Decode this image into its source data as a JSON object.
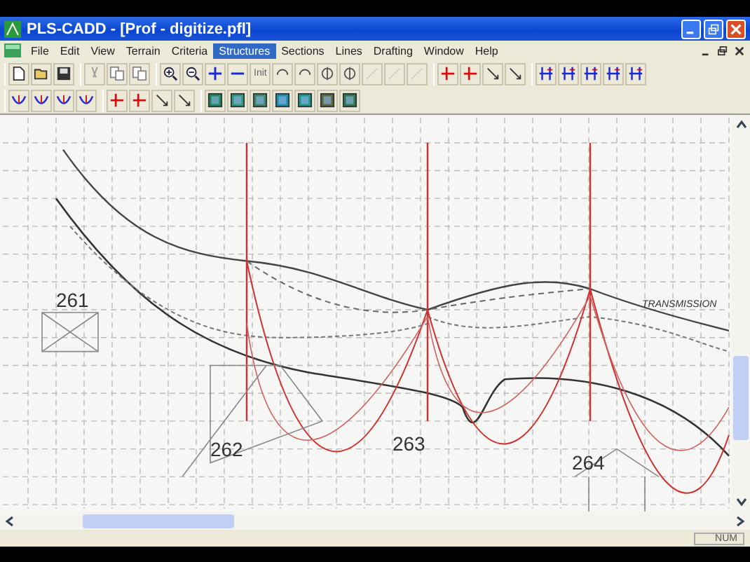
{
  "window": {
    "title": "PLS-CADD - [Prof - digitize.pfl]"
  },
  "menu": [
    {
      "label": "File",
      "selected": false
    },
    {
      "label": "Edit",
      "selected": false
    },
    {
      "label": "View",
      "selected": false
    },
    {
      "label": "Terrain",
      "selected": false
    },
    {
      "label": "Criteria",
      "selected": false
    },
    {
      "label": "Structures",
      "selected": true
    },
    {
      "label": "Sections",
      "selected": false
    },
    {
      "label": "Lines",
      "selected": false
    },
    {
      "label": "Drafting",
      "selected": false
    },
    {
      "label": "Window",
      "selected": false
    },
    {
      "label": "Help",
      "selected": false
    }
  ],
  "toolbar": {
    "init_label": "Init"
  },
  "canvas": {
    "structure_labels": [
      "261",
      "262",
      "263",
      "264"
    ],
    "note": "TRANSMISSION"
  },
  "status_bar": {
    "indicator": "NUM"
  }
}
